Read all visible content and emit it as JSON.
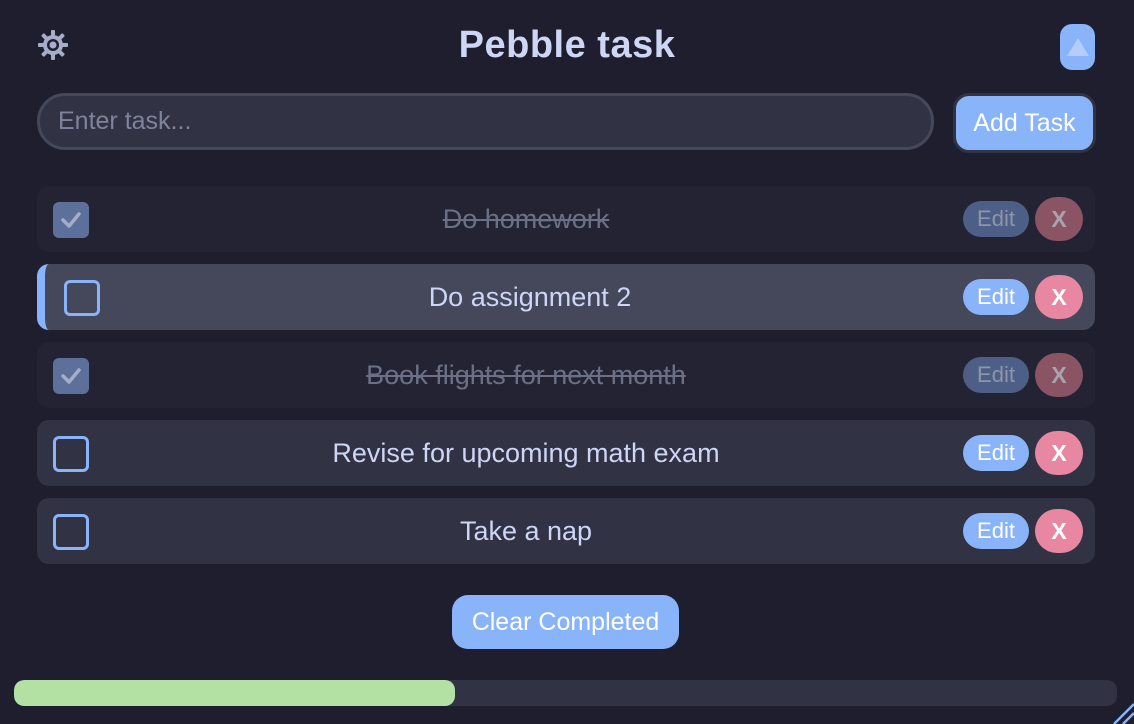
{
  "header": {
    "title": "Pebble task",
    "settings_icon": "gear-icon",
    "collapse_icon": "triangle-up-icon"
  },
  "input": {
    "placeholder": "Enter task...",
    "value": ""
  },
  "add_button_label": "Add Task",
  "tasks": [
    {
      "text": "Do homework",
      "completed": true,
      "edit_label": "Edit",
      "delete_label": "X"
    },
    {
      "text": "Do assignment 2",
      "completed": false,
      "edit_label": "Edit",
      "delete_label": "X"
    },
    {
      "text": "Book flights for next month",
      "completed": true,
      "edit_label": "Edit",
      "delete_label": "X"
    },
    {
      "text": "Revise for upcoming math exam",
      "completed": false,
      "edit_label": "Edit",
      "delete_label": "X"
    },
    {
      "text": "Take a nap",
      "completed": false,
      "edit_label": "Edit",
      "delete_label": "X"
    }
  ],
  "clear_button_label": "Clear Completed",
  "progress": {
    "completed_fraction": 0.4
  },
  "colors": {
    "background": "#1e1e2e",
    "accent": "#89b4fa",
    "danger": "#e887a2",
    "progress": "#b3e0a3",
    "text": "#cdd6f4"
  }
}
